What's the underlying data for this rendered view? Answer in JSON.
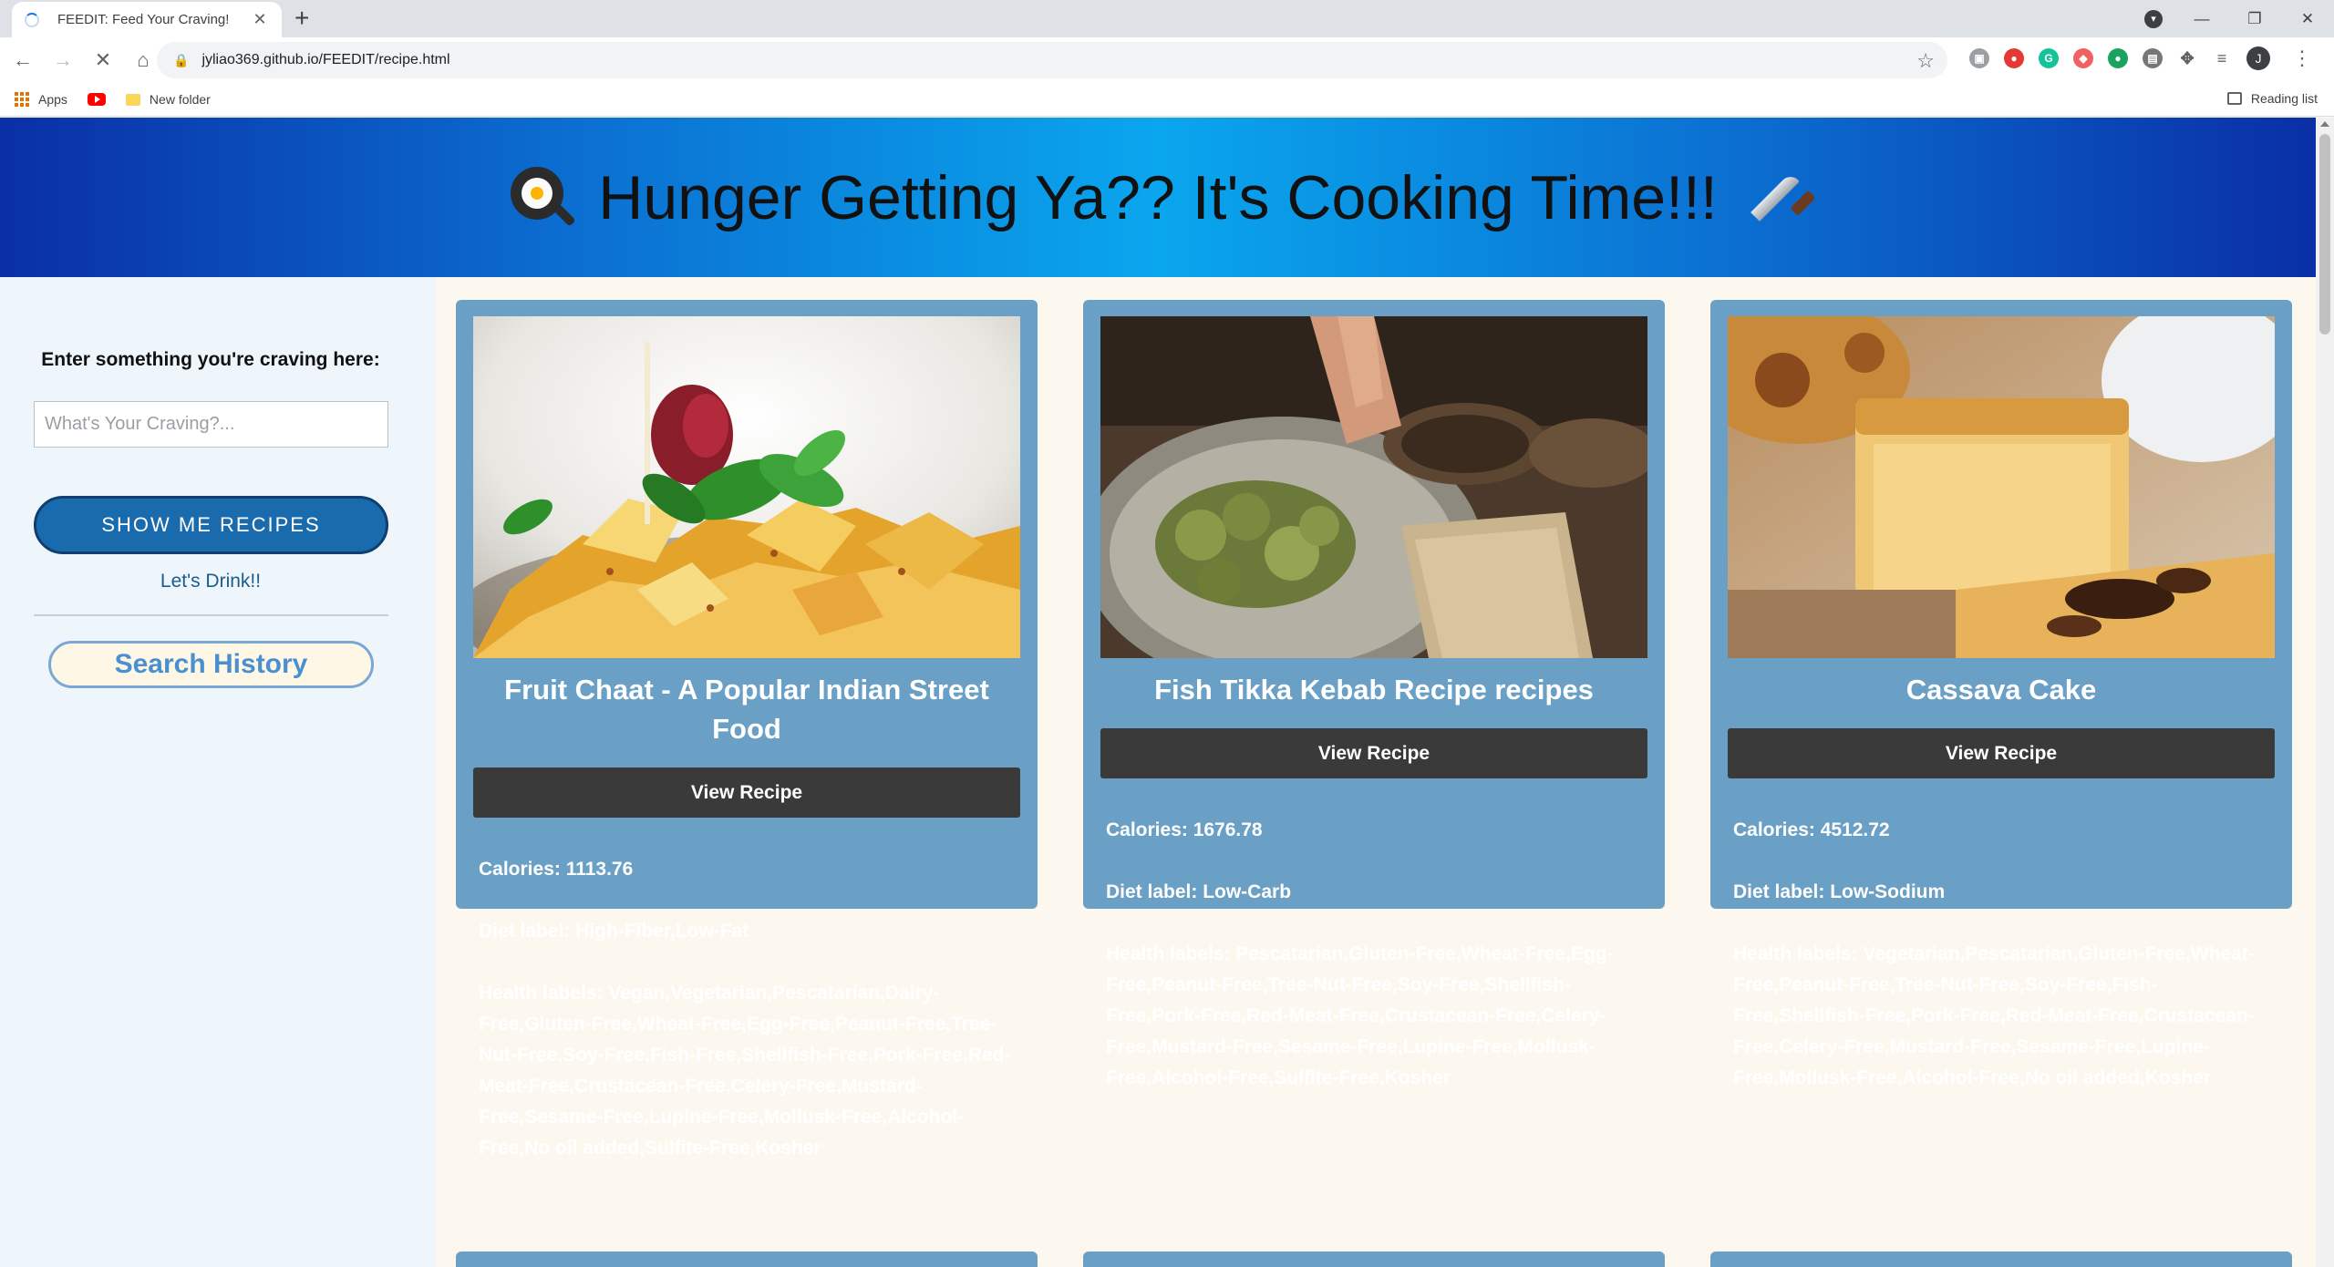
{
  "browser": {
    "tab_title": "FEEDIT: Feed Your Craving!",
    "url": "jyliao369.github.io/FEEDIT/recipe.html",
    "bookmarks": [
      "Apps",
      "New folder"
    ],
    "reading_list_label": "Reading list",
    "profile_initial": "J"
  },
  "header": {
    "title": "Hunger Getting Ya?? It's Cooking Time!!!"
  },
  "sidebar": {
    "prompt_label": "Enter something you're craving here:",
    "search_placeholder": "What's Your Craving?...",
    "search_value": "",
    "show_button": "SHOW ME RECIPES",
    "drink_link": "Let's Drink!!",
    "history_button": "Search History"
  },
  "recipes": [
    {
      "title": "Fruit Chaat - A Popular Indian Street Food",
      "button": "View Recipe",
      "calories": "Calories: 1113.76",
      "diet": "Diet label: High-Fiber,Low-Fat",
      "health": "Health labels: Vegan,Vegetarian,Pescatarian,Dairy-Free,Gluten-Free,Wheat-Free,Egg-Free,Peanut-Free,Tree-Nut-Free,Soy-Free,Fish-Free,Shellfish-Free,Pork-Free,Red-Meat-Free,Crustacean-Free,Celery-Free,Mustard-Free,Sesame-Free,Lupine-Free,Mollusk-Free,Alcohol-Free,No oil added,Sulfite-Free,Kosher"
    },
    {
      "title": "Fish Tikka Kebab Recipe recipes",
      "button": "View Recipe",
      "calories": "Calories: 1676.78",
      "diet": "Diet label: Low-Carb",
      "health": "Health labels: Pescatarian,Gluten-Free,Wheat-Free,Egg-Free,Peanut-Free,Tree-Nut-Free,Soy-Free,Shellfish-Free,Pork-Free,Red-Meat-Free,Crustacean-Free,Celery-Free,Mustard-Free,Sesame-Free,Lupine-Free,Mollusk-Free,Alcohol-Free,Sulfite-Free,Kosher"
    },
    {
      "title": "Cassava Cake",
      "button": "View Recipe",
      "calories": "Calories: 4512.72",
      "diet": "Diet label: Low-Sodium",
      "health": "Health labels: Vegetarian,Pescatarian,Gluten-Free,Wheat-Free,Peanut-Free,Tree-Nut-Free,Soy-Free,Fish-Free,Shellfish-Free,Pork-Free,Red-Meat-Free,Crustacean-Free,Celery-Free,Mustard-Free,Sesame-Free,Lupine-Free,Mollusk-Free,Alcohol-Free,No oil added,Kosher"
    }
  ],
  "icons": [
    "spinner-icon",
    "close-icon",
    "new-tab-icon",
    "back-icon",
    "forward-icon",
    "reload-icon",
    "home-icon",
    "lock-icon",
    "star-icon",
    "puzzle-icon",
    "menu-icon",
    "apps-icon",
    "youtube-icon",
    "folder-icon",
    "frying-pan-icon",
    "knife-icon"
  ],
  "colors": {
    "header_gradient_center": "#0aa6ee",
    "header_gradient_edge": "#0a2fa6",
    "card_bg": "#6aa0c6",
    "view_button_bg": "#3a3a3a",
    "show_button_bg": "#1a6aae",
    "page_bg": "#fdf8ef",
    "sidebar_bg": "#eef5fb"
  }
}
